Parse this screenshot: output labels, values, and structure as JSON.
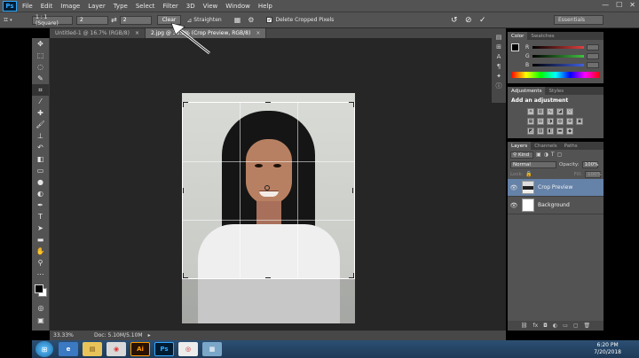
{
  "app": {
    "logo": "Ps"
  },
  "menu": [
    "File",
    "Edit",
    "Image",
    "Layer",
    "Type",
    "Select",
    "Filter",
    "3D",
    "View",
    "Window",
    "Help"
  ],
  "window_controls": [
    "—",
    "☐",
    "✕"
  ],
  "options_bar": {
    "ratio_preset": "1 : 1 (Square)",
    "width_value": "2",
    "height_value": "2",
    "clear_label": "Clear",
    "straighten_label": "Straighten",
    "delete_cropped_label": "Delete Cropped Pixels",
    "workspace_label": "Essentials"
  },
  "doc_tabs": [
    {
      "label": "Untitled-1 @ 16.7% (RGB/8)",
      "close": "×"
    },
    {
      "label": "2.jpg @ 33.3% (Crop Preview, RGB/8)",
      "close": "×"
    }
  ],
  "panels": {
    "color_tabs": [
      "Color",
      "Swatches"
    ],
    "color_channels": [
      {
        "label": "R",
        "color": "#e04040"
      },
      {
        "label": "G",
        "color": "#40c040"
      },
      {
        "label": "B",
        "color": "#4060e0"
      }
    ],
    "adjustments_tabs": [
      "Adjustments",
      "Styles"
    ],
    "adjustments_title": "Add an adjustment",
    "layers_tabs": [
      "Layers",
      "Channels",
      "Paths"
    ],
    "layers_kind": "Kind",
    "blend_mode": "Normal",
    "opacity_label": "Opacity:",
    "opacity_value": "100%",
    "lock_label": "Lock:",
    "fill_label": "Fill:",
    "fill_value": "100%",
    "layers": [
      {
        "name": "Crop Preview",
        "selected": true
      },
      {
        "name": "Background",
        "selected": false
      }
    ]
  },
  "status": {
    "zoom": "33.33%",
    "doc": "Doc: 5.10M/5.10M"
  },
  "taskbar": {
    "apps": [
      "e",
      "▤",
      "◉",
      "Ai",
      "Ps",
      "◎",
      "▦"
    ],
    "time": "6:20 PM",
    "date": "7/20/2018"
  }
}
